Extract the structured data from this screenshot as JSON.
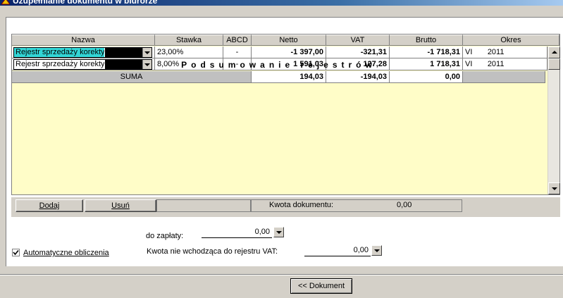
{
  "window": {
    "title": "Uzupełnianie dokumentu w biurorze"
  },
  "grid": {
    "columns": [
      "Nazwa",
      "Stawka",
      "ABCD",
      "Netto",
      "VAT",
      "Brutto",
      "Okres"
    ],
    "rows": [
      {
        "nazwa": "Rejestr sprzedaży korekty",
        "stawka": "23,00%",
        "abcd": "-",
        "netto": "-1 397,00",
        "vat": "-321,31",
        "brutto": "-1 718,31",
        "okres_m": "VI",
        "okres_y": "2011",
        "highlight": "#33d7d7"
      },
      {
        "nazwa": "Rejestr sprzedaży korekty",
        "stawka": "8,00%",
        "abcd": "-",
        "netto": "1 591,03",
        "vat": "127,28",
        "brutto": "1 718,31",
        "okres_m": "VI",
        "okres_y": "2011"
      }
    ],
    "summary_title": "Podsumowanie rejestrów",
    "summary": {
      "label": "SUMA",
      "netto": "194,03",
      "vat": "-194,03",
      "brutto": "0,00"
    }
  },
  "buttons": {
    "add": "Dodaj",
    "remove": "Usuń",
    "document": "<< Dokument"
  },
  "kwota": {
    "label": "Kwota dokumentu:",
    "value": "0,00"
  },
  "form": {
    "do_zaplaty_label": "do zapłaty:",
    "do_zaplaty_value": "0,00",
    "auto_calc_label": "Automatyczne obliczenia",
    "auto_calc_checked": true,
    "nie_vat_label": "Kwota nie wchodząca do rejestru VAT:",
    "nie_vat_value": "0,00"
  },
  "colors": {
    "grid_bg": "#fffdc8",
    "highlight": "#33d7d7",
    "chrome": "#d4d0c8"
  }
}
